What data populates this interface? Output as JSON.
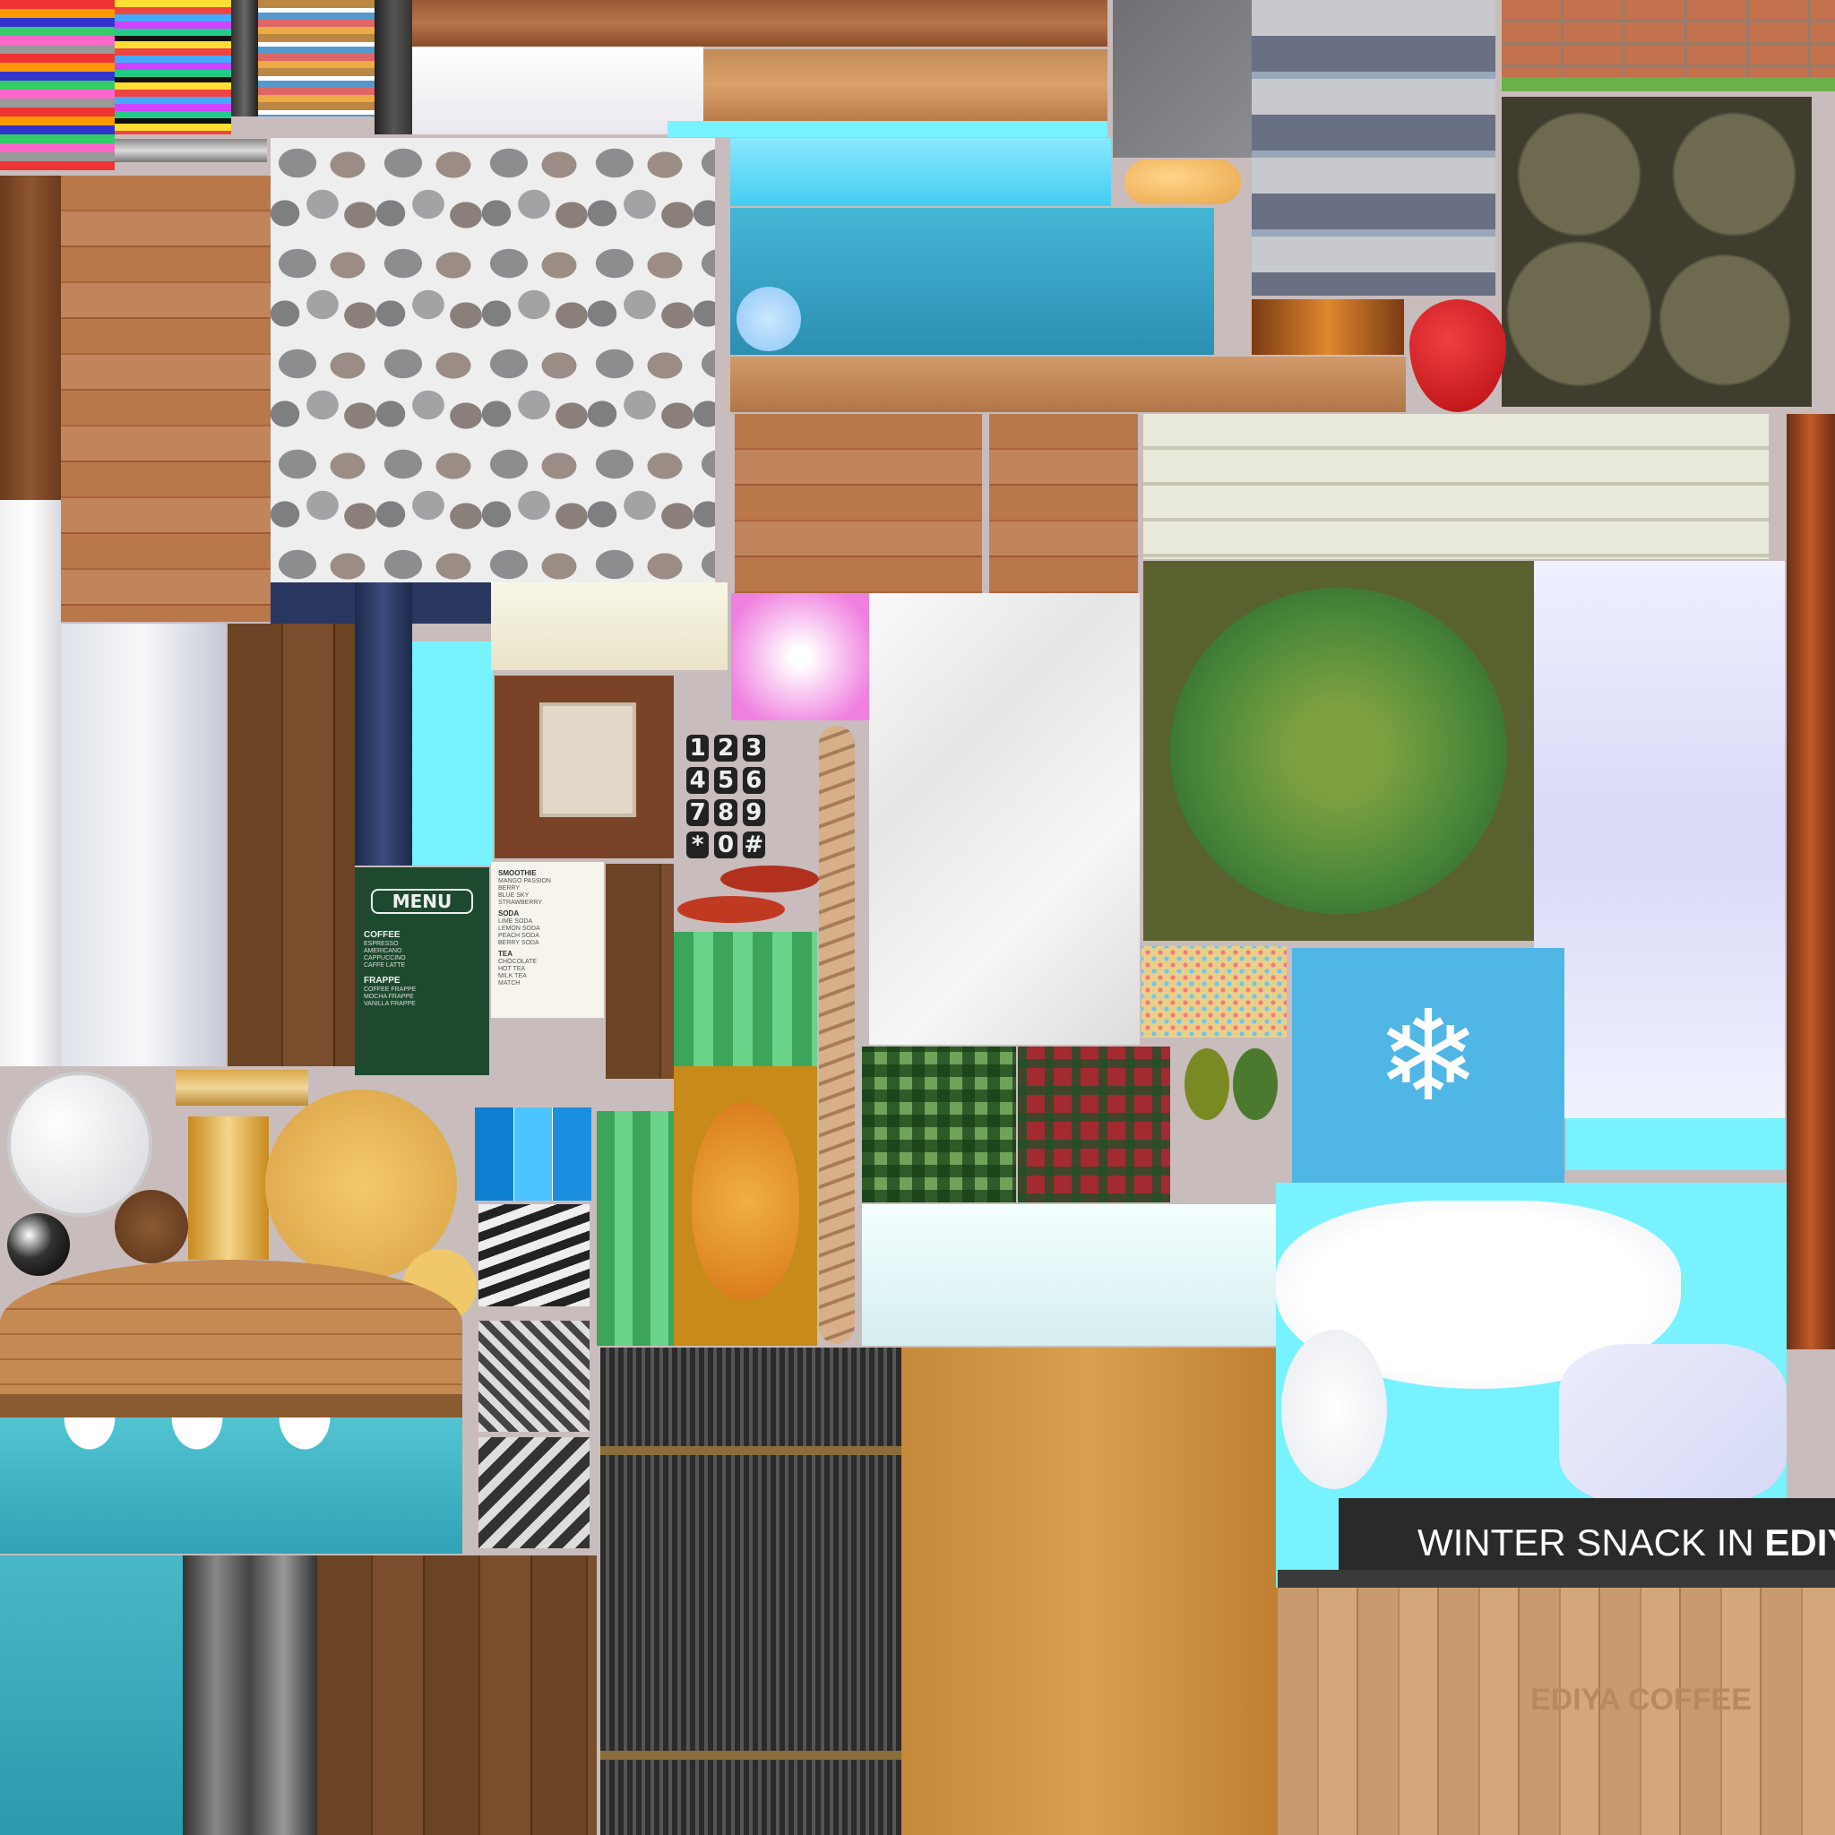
{
  "atlas": {
    "menu_board": {
      "title": "MENU",
      "sections": [
        {
          "heading": "COFFEE",
          "items": [
            "ESPRESSO",
            "AMERICANO",
            "CAPPUCCINO",
            "CAFFE LATTE"
          ]
        },
        {
          "heading": "FRAPPE",
          "items": [
            "COFFEE FRAPPE",
            "MOCHA FRAPPE",
            "VANILLA FRAPPE"
          ]
        }
      ]
    },
    "paper_menu": {
      "sections": [
        {
          "heading": "SMOOTHIE",
          "items": [
            "MANGO PASSION",
            "BERRY",
            "BLUE SKY",
            "STRAWBERRY"
          ]
        },
        {
          "heading": "SODA",
          "items": [
            "LIME SODA",
            "LEMON SODA",
            "PEACH SODA",
            "BERRY SODA"
          ]
        },
        {
          "heading": "TEA",
          "items": [
            "CHOCOLATE",
            "HOT TEA",
            "MILK TEA",
            "MATCH"
          ]
        }
      ]
    },
    "keypad_keys": [
      "1",
      "2",
      "3",
      "4",
      "5",
      "6",
      "7",
      "8",
      "9",
      "*",
      "0",
      "#"
    ],
    "banner_text_light": "WINTER SNACK IN ",
    "banner_text_bold": "EDIYA",
    "sign_text": "EDIYA COFFEE"
  }
}
